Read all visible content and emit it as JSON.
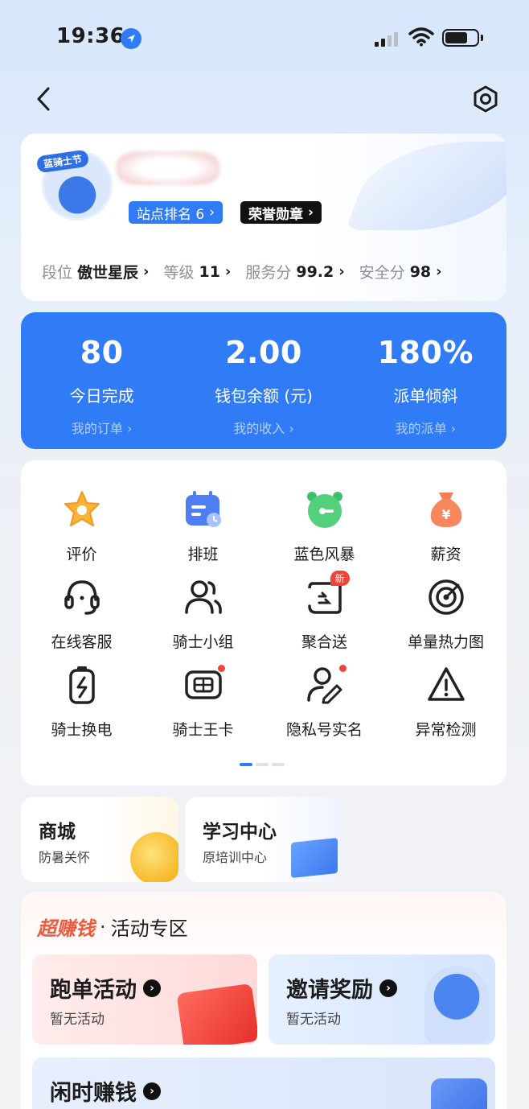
{
  "status": {
    "time": "19:36"
  },
  "profile": {
    "avatar_badge": "蓝骑士节",
    "rank_tag": "站点排名 6",
    "honor_tag": "荣誉勋章",
    "stats": [
      {
        "key": "段位",
        "value": "傲世星辰"
      },
      {
        "key": "等级",
        "value": "11"
      },
      {
        "key": "服务分",
        "value": "99.2"
      },
      {
        "key": "安全分",
        "value": "98"
      }
    ]
  },
  "summary": [
    {
      "value": "80",
      "label": "今日完成",
      "link": "我的订单 ›"
    },
    {
      "value": "2.00",
      "label": "钱包余额 (元)",
      "link": "我的收入 ›"
    },
    {
      "value": "180%",
      "label": "派单倾斜",
      "link": "我的派单 ›"
    }
  ],
  "grid": [
    {
      "label": "评价"
    },
    {
      "label": "排班"
    },
    {
      "label": "蓝色风暴"
    },
    {
      "label": "薪资"
    },
    {
      "label": "在线客服"
    },
    {
      "label": "骑士小组"
    },
    {
      "label": "聚合送",
      "badge": "新"
    },
    {
      "label": "单量热力图"
    },
    {
      "label": "骑士换电"
    },
    {
      "label": "骑士王卡"
    },
    {
      "label": "隐私号实名"
    },
    {
      "label": "异常检测"
    }
  ],
  "mall": {
    "title": "商城",
    "subtitle": "防暑关怀"
  },
  "learning": {
    "title": "学习中心",
    "subtitle": "原培训中心"
  },
  "activity": {
    "hot_label": "超赚钱",
    "zone_label": "活动专区",
    "run": {
      "title": "跑单活动",
      "subtitle": "暂无活动"
    },
    "invite": {
      "title": "邀请奖励",
      "subtitle": "暂无活动"
    },
    "idle": {
      "title": "闲时赚钱"
    }
  },
  "colors": {
    "accent": "#2f7cf6",
    "red": "#f0433a",
    "hot": "#f05a3c"
  }
}
